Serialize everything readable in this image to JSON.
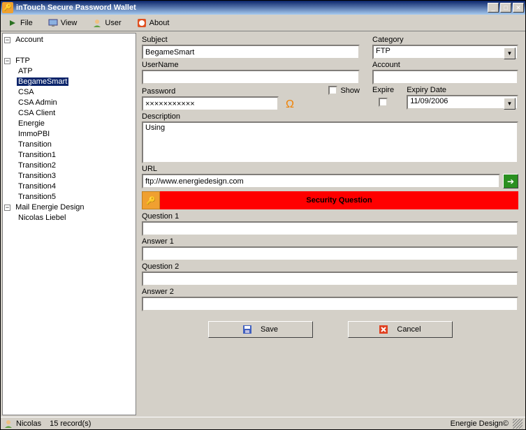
{
  "window": {
    "title": "inTouch Secure Password Wallet"
  },
  "menu": {
    "file": "File",
    "view": "View",
    "user": "User",
    "about": "About"
  },
  "tree": {
    "root1": "Account",
    "root2": "FTP",
    "ftp": [
      "ATP",
      "BegameSmart",
      "CSA",
      "CSA Admin",
      "CSA Client",
      "Energie",
      "ImmoPBI",
      "Transition",
      "Transition1",
      "Transition2",
      "Transition3",
      "Transition4",
      "Transition5"
    ],
    "selected": "BegameSmart",
    "root3": "Mail Energie Design",
    "mail": [
      "Nicolas Liebel"
    ]
  },
  "form": {
    "subject_label": "Subject",
    "subject_value": "BegameSmart",
    "category_label": "Category",
    "category_value": "FTP",
    "username_label": "UserName",
    "username_value": "",
    "account_label": "Account",
    "account_value": "",
    "password_label": "Password",
    "password_value": "×××××××××××",
    "show_label": "Show",
    "expire_label": "Expire",
    "expiry_label": "Expiry Date",
    "expiry_value": "11/09/2006",
    "description_label": "Description",
    "description_value": "Using",
    "url_label": "URL",
    "url_value": "ftp://www.energiedesign.com",
    "security_banner": "Security Question",
    "question1_label": "Question 1",
    "question1_value": "",
    "answer1_label": "Answer 1",
    "answer1_value": "",
    "question2_label": "Question 2",
    "question2_value": "",
    "answer2_label": "Answer 2",
    "answer2_value": "",
    "save_label": "Save",
    "cancel_label": "Cancel"
  },
  "status": {
    "user": "Nicolas",
    "records": "15 record(s)",
    "right": "Energie Design©"
  }
}
